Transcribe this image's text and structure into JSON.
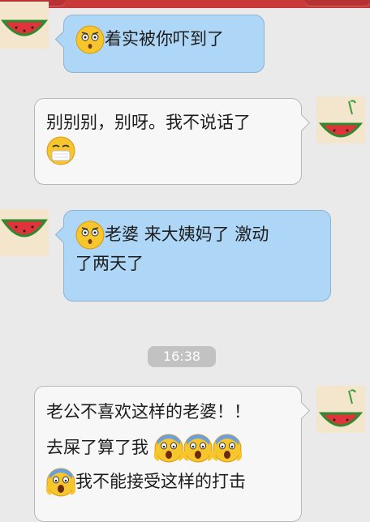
{
  "colors": {
    "outgoing_bubble": "#aed6f6",
    "incoming_bubble": "#f7f7f7",
    "background": "#eaeaea",
    "top_bar": "#c9393a",
    "timestamp_pill": "#c2c2c2"
  },
  "messages": [
    {
      "side": "left",
      "emoji": "shocked-face-icon",
      "text": "着实被你吓到了"
    },
    {
      "side": "right",
      "line1": "别别别，别呀。我不说话了",
      "emoji": "masked-face-icon"
    },
    {
      "side": "left",
      "emoji": "shocked-face-icon",
      "line1": "老婆 来大姨妈了 激动",
      "line2": "了两天了"
    },
    {
      "timestamp": "16:38"
    },
    {
      "side": "right",
      "line1": "老公不喜欢这样的老婆！！",
      "line2": "去屎了算了我",
      "emojis": [
        "scream-icon",
        "scream-icon",
        "scream-icon",
        "scream-icon"
      ],
      "line3": "我不能接受这样的打击"
    }
  ]
}
